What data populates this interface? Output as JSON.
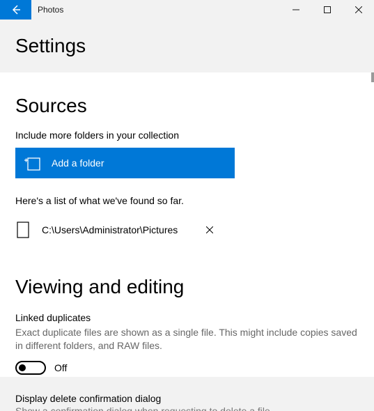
{
  "app_title": "Photos",
  "page_title": "Settings",
  "sources": {
    "heading": "Sources",
    "include_text": "Include more folders in your collection",
    "add_button": "Add a folder",
    "found_text": "Here's a list of what we've found so far.",
    "folder_path": "C:\\Users\\Administrator\\Pictures"
  },
  "viewing": {
    "heading": "Viewing and editing",
    "linked_title": "Linked duplicates",
    "linked_desc": "Exact duplicate files are shown as a single file. This might include copies saved in different folders, and RAW files.",
    "toggle_state": "Off",
    "delete_title": "Display delete confirmation dialog",
    "delete_desc_partial": "Show a confirmation dialog when requesting to delete a file"
  }
}
